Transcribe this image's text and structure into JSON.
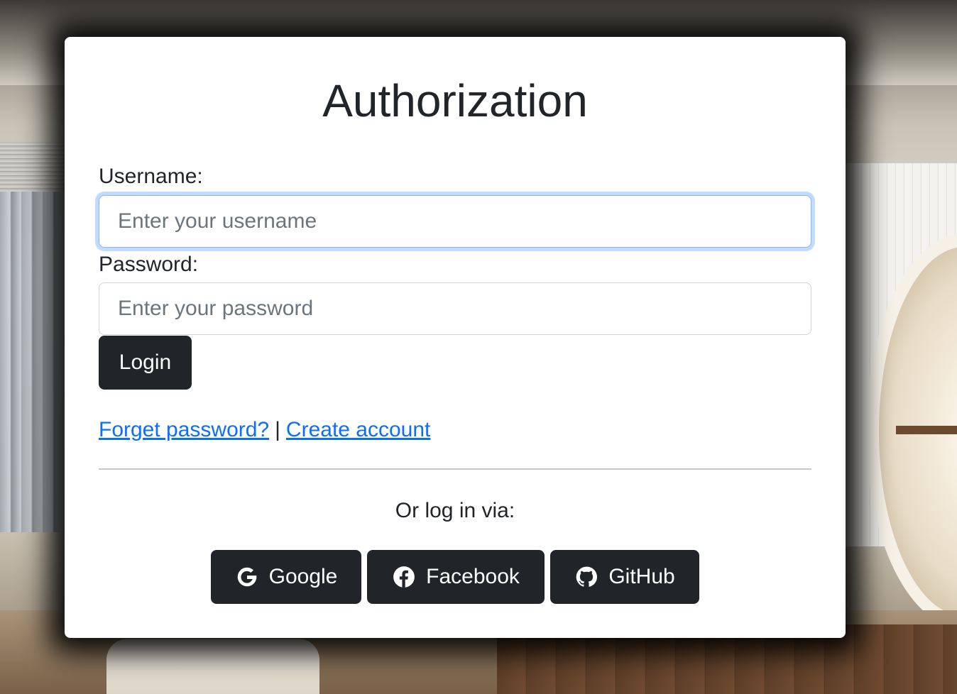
{
  "auth": {
    "title": "Authorization",
    "username_label": "Username:",
    "username_placeholder": "Enter your username",
    "password_label": "Password:",
    "password_placeholder": "Enter your password",
    "login_label": "Login",
    "forgot_link": "Forget password?",
    "separator": "|",
    "create_link": "Create account",
    "or_text": "Or log in via:"
  },
  "social": {
    "google": {
      "label": "Google",
      "icon": "google-icon"
    },
    "facebook": {
      "label": "Facebook",
      "icon": "facebook-icon"
    },
    "github": {
      "label": "GitHub",
      "icon": "github-icon"
    }
  },
  "colors": {
    "button_dark": "#212529",
    "link": "#0d6efd",
    "focus_ring": "#86b7fe",
    "text": "#212529"
  }
}
